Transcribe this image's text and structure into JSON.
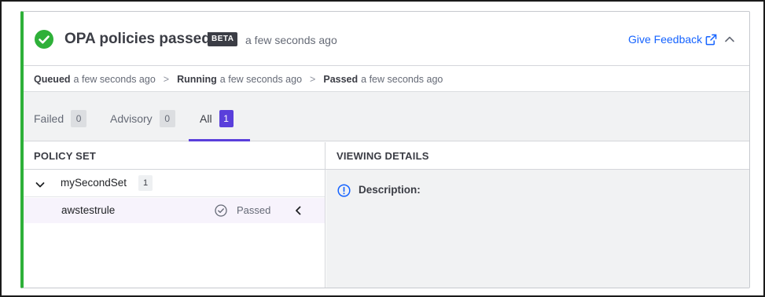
{
  "header": {
    "title": "OPA policies passed",
    "badge": "BETA",
    "timestamp": "a few seconds ago",
    "feedback_label": "Give Feedback",
    "status_color": "#2eb039"
  },
  "timeline": {
    "steps": [
      {
        "label": "Queued",
        "time": "a few seconds ago"
      },
      {
        "label": "Running",
        "time": "a few seconds ago"
      },
      {
        "label": "Passed",
        "time": "a few seconds ago"
      }
    ],
    "separator": ">"
  },
  "tabs": [
    {
      "label": "Failed",
      "count": "0"
    },
    {
      "label": "Advisory",
      "count": "0"
    },
    {
      "label": "All",
      "count": "1",
      "active": true
    }
  ],
  "columns": {
    "left": "POLICY SET",
    "right": "VIEWING DETAILS"
  },
  "policy_sets": [
    {
      "name": "mySecondSet",
      "count": "1",
      "rules": [
        {
          "name": "awstestrule",
          "status": "Passed"
        }
      ]
    }
  ],
  "details": {
    "description_label": "Description:"
  },
  "colors": {
    "accent": "#5a3fdb",
    "link": "#1563ff",
    "success": "#2eb039"
  }
}
